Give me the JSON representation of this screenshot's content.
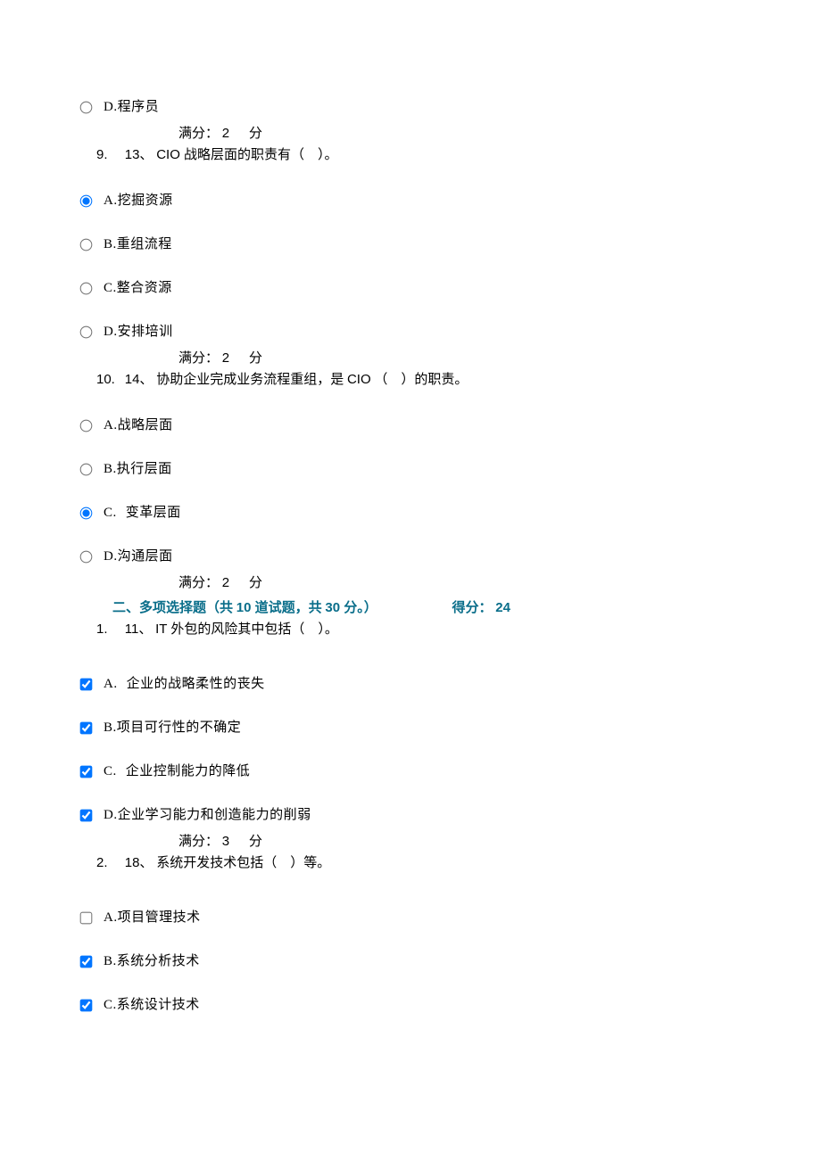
{
  "q_prev": {
    "options": [
      {
        "letter": "D.",
        "text": "程序员",
        "checked": false
      }
    ],
    "score_prefix": "满分：",
    "score_value": "2",
    "score_suffix": "分"
  },
  "q9": {
    "index": "9. ",
    "number": "13、",
    "stem_a": "CIO ",
    "stem_b": "战略层面的职责有（　）。",
    "options": [
      {
        "letter": "A.",
        "text": "挖掘资源",
        "checked": true
      },
      {
        "letter": "B.",
        "text": "重组流程",
        "checked": false
      },
      {
        "letter": "C.",
        "text": "整合资源",
        "checked": false
      },
      {
        "letter": "D.",
        "text": "安排培训",
        "checked": false
      }
    ],
    "score_prefix": "满分：",
    "score_value": "2",
    "score_suffix": "分"
  },
  "q10": {
    "index": "10. ",
    "number": "14、",
    "stem_a": "协助企业完成业务流程重组，是",
    "stem_b": " CIO",
    "stem_c": "（　）的职责。",
    "options": [
      {
        "letter": "A.",
        "text": "战略层面",
        "checked": false
      },
      {
        "letter": "B.",
        "text": "执行层面",
        "checked": false
      },
      {
        "letter": "C. ",
        "text": "变革层面",
        "checked": true
      },
      {
        "letter": "D.",
        "text": "沟通层面",
        "checked": false
      }
    ],
    "score_prefix": "满分：",
    "score_value": "2",
    "score_suffix": "分"
  },
  "section2": {
    "title_a": "二、多项选择题（共",
    "count": " 10 ",
    "title_b": "道试题，共",
    "points": " 30 ",
    "title_c": "分。）",
    "score_label": "得分：",
    "score_value": "24"
  },
  "mq1": {
    "index": "1. ",
    "number": "11、",
    "stem_a": "IT ",
    "stem_b": "外包的风险其中包括（　）。",
    "options": [
      {
        "letter": "A. ",
        "text": "企业的战略柔性的丧失",
        "checked": true
      },
      {
        "letter": "B.",
        "text": "项目可行性的不确定",
        "checked": true
      },
      {
        "letter": "C. ",
        "text": "企业控制能力的降低",
        "checked": true
      },
      {
        "letter": "D.",
        "text": "企业学习能力和创造能力的削弱",
        "checked": true
      }
    ],
    "score_prefix": "满分：",
    "score_value": "3",
    "score_suffix": "分"
  },
  "mq2": {
    "index": "2. ",
    "number": "18、",
    "stem": "系统开发技术包括（　）等。",
    "options": [
      {
        "letter": "A.",
        "text": "项目管理技术",
        "checked": false
      },
      {
        "letter": "B.",
        "text": "系统分析技术",
        "checked": true
      },
      {
        "letter": "C.",
        "text": "系统设计技术",
        "checked": true
      }
    ]
  }
}
